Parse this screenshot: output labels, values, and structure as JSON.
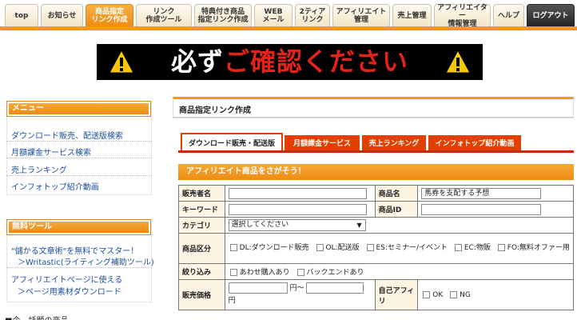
{
  "nav": {
    "tabs": [
      {
        "label": "top"
      },
      {
        "label": "お知らせ"
      },
      {
        "label": "商品指定\nリンク作成"
      },
      {
        "label": "リンク\n作成ツール"
      },
      {
        "label": "特典付き商品\n指定リンク作成"
      },
      {
        "label": "WEB\nメール"
      },
      {
        "label": "2ティア\nリンク"
      },
      {
        "label": "アフィリエイト\n管理"
      },
      {
        "label": "売上管理"
      },
      {
        "label": "アフィリエイター\n情報管理"
      },
      {
        "label": "ヘルプ"
      },
      {
        "label": "ログアウト"
      }
    ],
    "active_index": 2
  },
  "banner": {
    "text_white": "必ず",
    "text_red": "ご確認ください",
    "icon_left": "warning-icon",
    "icon_right": "warning-icon"
  },
  "sidebar": {
    "menu_title": "メニュー",
    "menu_items": [
      "ダウンロード販売、配送版検索",
      "月額課金サービス検索",
      "売上ランキング",
      "インフォトップ紹介動画"
    ],
    "tools_title": "無料ツール",
    "tools_items": [
      "\"儲かる文章術\"を無料でマスター！",
      "＞Writastic(ライティング補助ツール)",
      "アフィリエイトページに使える",
      "＞ページ用素材ダウンロード"
    ],
    "bottom_label": "■今、話題の商品"
  },
  "main": {
    "title": "商品指定リンク作成",
    "tabs": [
      "ダウンロード販売・配送版",
      "月額課金サービス",
      "売上ランキング",
      "インフォトップ紹介動画"
    ],
    "search_header": "アフィリエイト商品をさがそう！",
    "form": {
      "seller_label": "販売者名",
      "seller_value": "",
      "product_label": "商品名",
      "product_value": "馬券を支配する予想",
      "keyword_label": "キーワード",
      "keyword_value": "",
      "product_id_label": "商品ID",
      "product_id_value": "",
      "category_label": "カテゴリ",
      "category_value": "選択してください",
      "division_label": "商品区分",
      "division_options": [
        "DL:ダウンロード販売",
        "OL:配送版",
        "ES:セミナー/イベント",
        "EC:物販",
        "FO:無料オファー用"
      ],
      "filter_label": "絞り込み",
      "filter_options": [
        "あわせ購入あり",
        "バックエンドあり"
      ],
      "price_label": "販売価格",
      "price_from": "",
      "price_unit_1": "円～",
      "price_to": "",
      "price_unit_2": "円",
      "self_aff_label": "自己アフィリ",
      "self_aff_options": [
        "OK",
        "NG"
      ]
    }
  },
  "colors": {
    "accent_orange": "#f39a1b",
    "tab_red": "#e24000",
    "link_blue": "#1a4fa0",
    "banner_red": "#e2231a"
  }
}
